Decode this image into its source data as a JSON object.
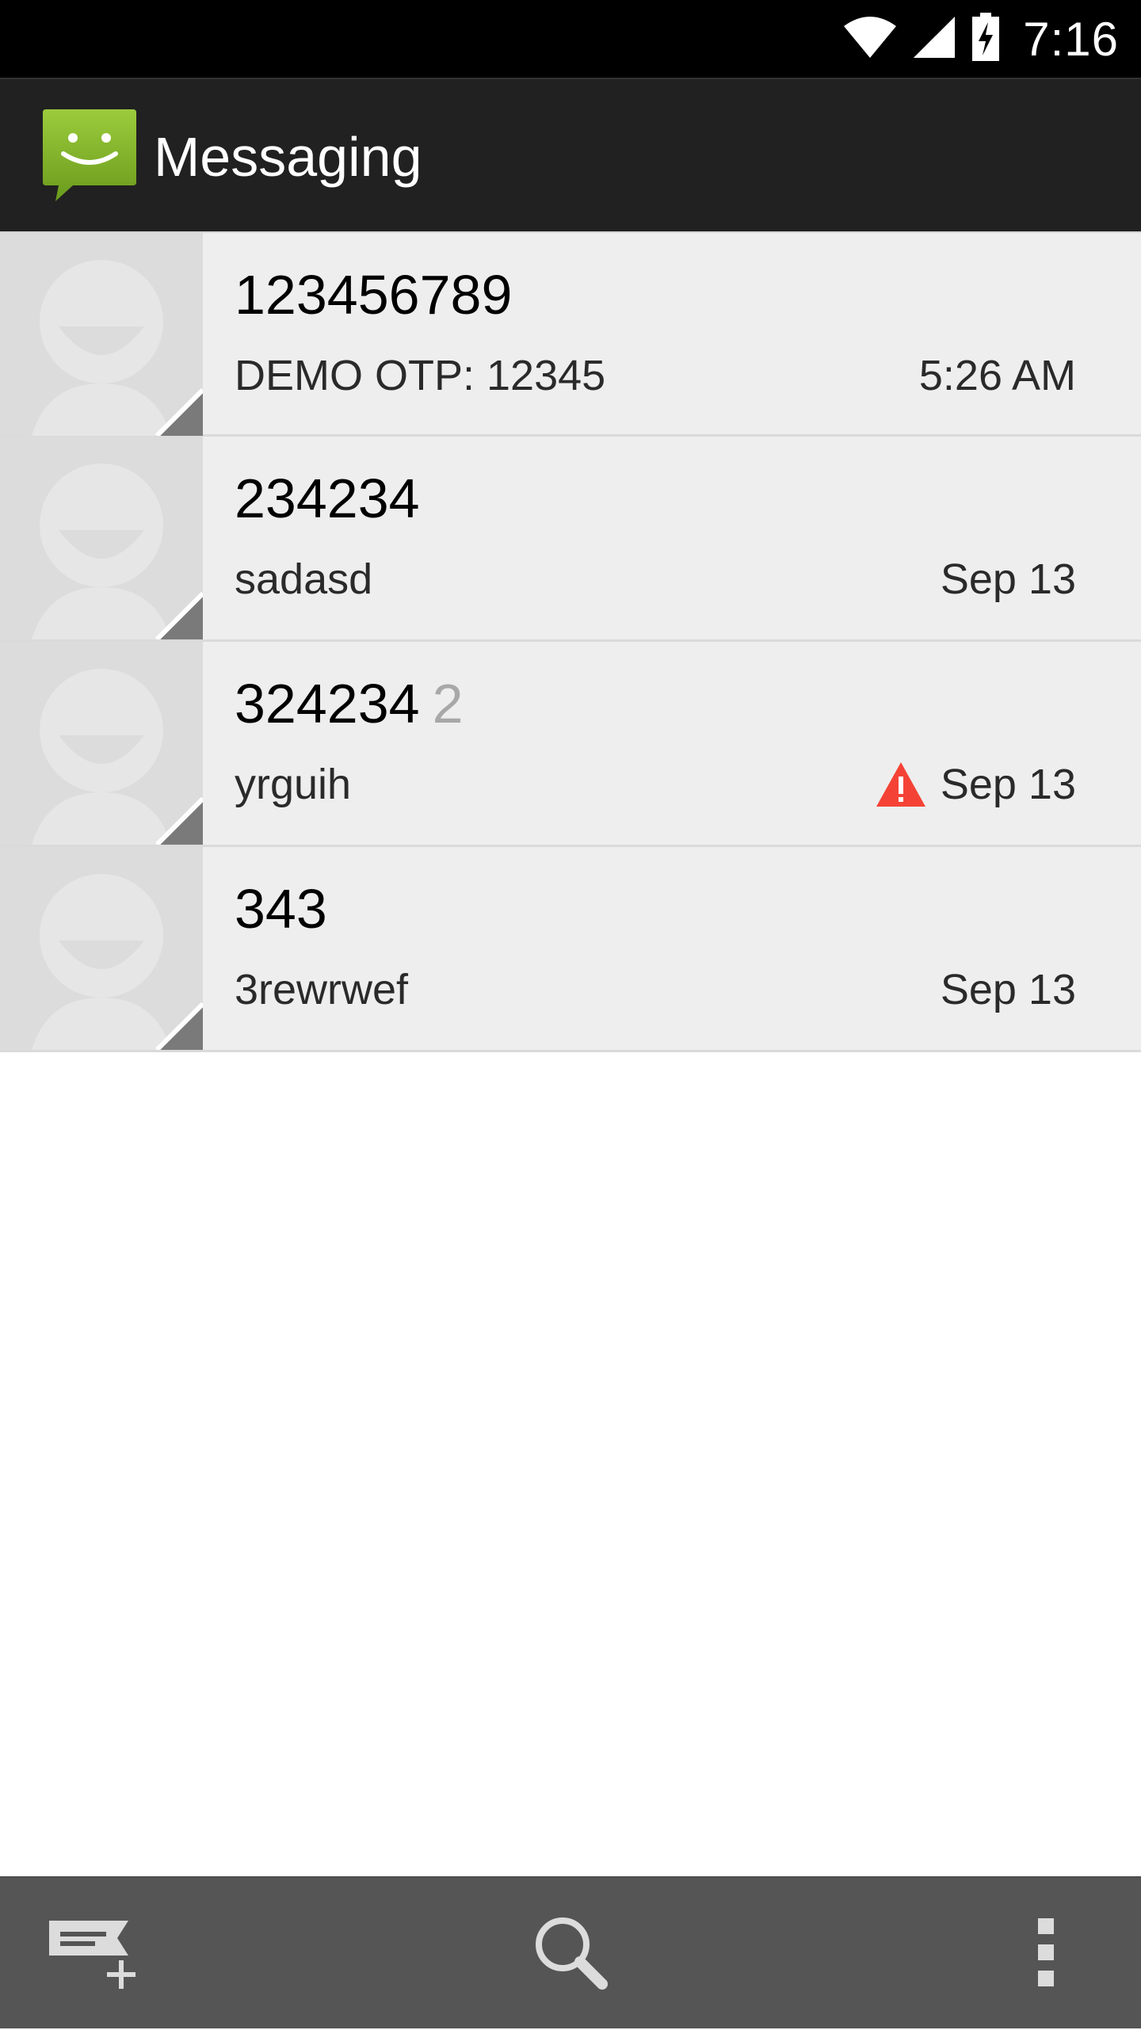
{
  "status_bar": {
    "time": "7:16",
    "icons": [
      "wifi-icon",
      "cell-signal-icon",
      "battery-charging-icon"
    ]
  },
  "action_bar": {
    "title": "Messaging",
    "logo_icon": "messaging-smiley-icon"
  },
  "conversations": [
    {
      "name": "123456789",
      "count": "",
      "snippet": "DEMO OTP: 12345",
      "date": "5:26 AM",
      "error": false
    },
    {
      "name": "234234",
      "count": "",
      "snippet": "sadasd",
      "date": "Sep 13",
      "error": false
    },
    {
      "name": "324234",
      "count": "2",
      "snippet": "yrguih",
      "date": "Sep 13",
      "error": true
    },
    {
      "name": "343",
      "count": "",
      "snippet": "3rewrwef",
      "date": "Sep 13",
      "error": false
    }
  ],
  "bottom_bar": {
    "actions": [
      "new-message-icon",
      "search-icon",
      "overflow-menu-icon"
    ]
  },
  "colors": {
    "status_bar": "#000000",
    "action_bar": "#212121",
    "row_bg": "#eeeeee",
    "avatar_bg": "#dcdcdc",
    "error_red": "#f44336",
    "bottom_bar": "#555555",
    "logo_green": "#8bc34a"
  }
}
